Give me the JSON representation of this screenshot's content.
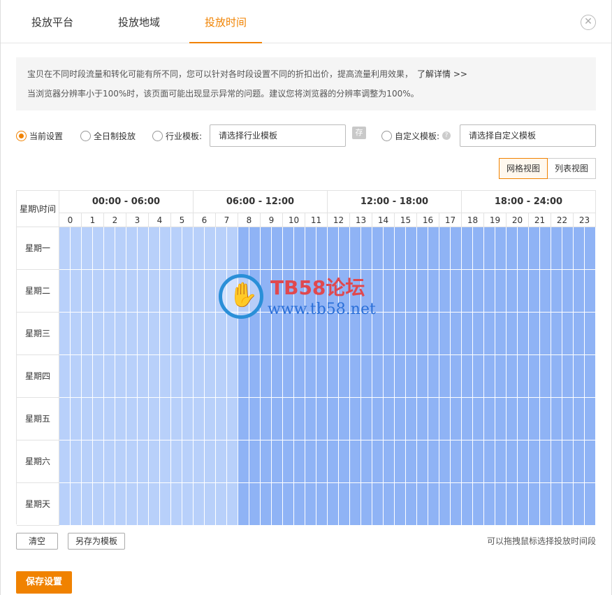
{
  "tabs": [
    {
      "label": "投放平台",
      "active": false
    },
    {
      "label": "投放地域",
      "active": false
    },
    {
      "label": "投放时间",
      "active": true
    }
  ],
  "close_icon": "close-icon",
  "notice": {
    "line1": "宝贝在不同时段流量和转化可能有所不同，您可以针对各时段设置不同的折扣出价，提高流量利用效果，",
    "link": "了解详情 >>",
    "line2": "当浏览器分辨率小于100%时，该页面可能出现显示异常的问题。建议您将浏览器的分辨率调整为100%。"
  },
  "options": {
    "current_label": "当前设置",
    "allday_label": "全日制投放",
    "industry_label": "行业模板:",
    "industry_placeholder": "请选择行业模板",
    "save_icon_char": "存",
    "custom_label": "自定义模板:",
    "help_char": "?",
    "custom_placeholder": "请选择自定义模板",
    "selected": "current"
  },
  "view_toggle": {
    "grid_label": "网格视图",
    "list_label": "列表视图",
    "active": "grid"
  },
  "grid": {
    "corner_label": "星期\\时间",
    "ranges": [
      "00:00 - 06:00",
      "06:00 - 12:00",
      "12:00 - 18:00",
      "18:00 - 24:00"
    ],
    "hours": [
      "0",
      "1",
      "2",
      "3",
      "4",
      "5",
      "6",
      "7",
      "8",
      "9",
      "10",
      "11",
      "12",
      "13",
      "14",
      "15",
      "16",
      "17",
      "18",
      "19",
      "20",
      "21",
      "22",
      "23"
    ],
    "days": [
      "星期一",
      "星期二",
      "星期三",
      "星期四",
      "星期五",
      "星期六",
      "星期天"
    ],
    "light_hours": [
      0,
      1,
      2,
      3,
      4,
      5,
      6,
      7
    ],
    "selected_color": "#8fb3f5",
    "light_color": "#b8d0fa"
  },
  "watermark": {
    "title": "TB58论坛",
    "url": "www.tb58.net"
  },
  "footer": {
    "clear_label": "清空",
    "save_template_label": "另存为模板",
    "hint": "可以拖拽鼠标选择投放时间段",
    "save_label": "保存设置"
  },
  "accent_color": "#f08200"
}
